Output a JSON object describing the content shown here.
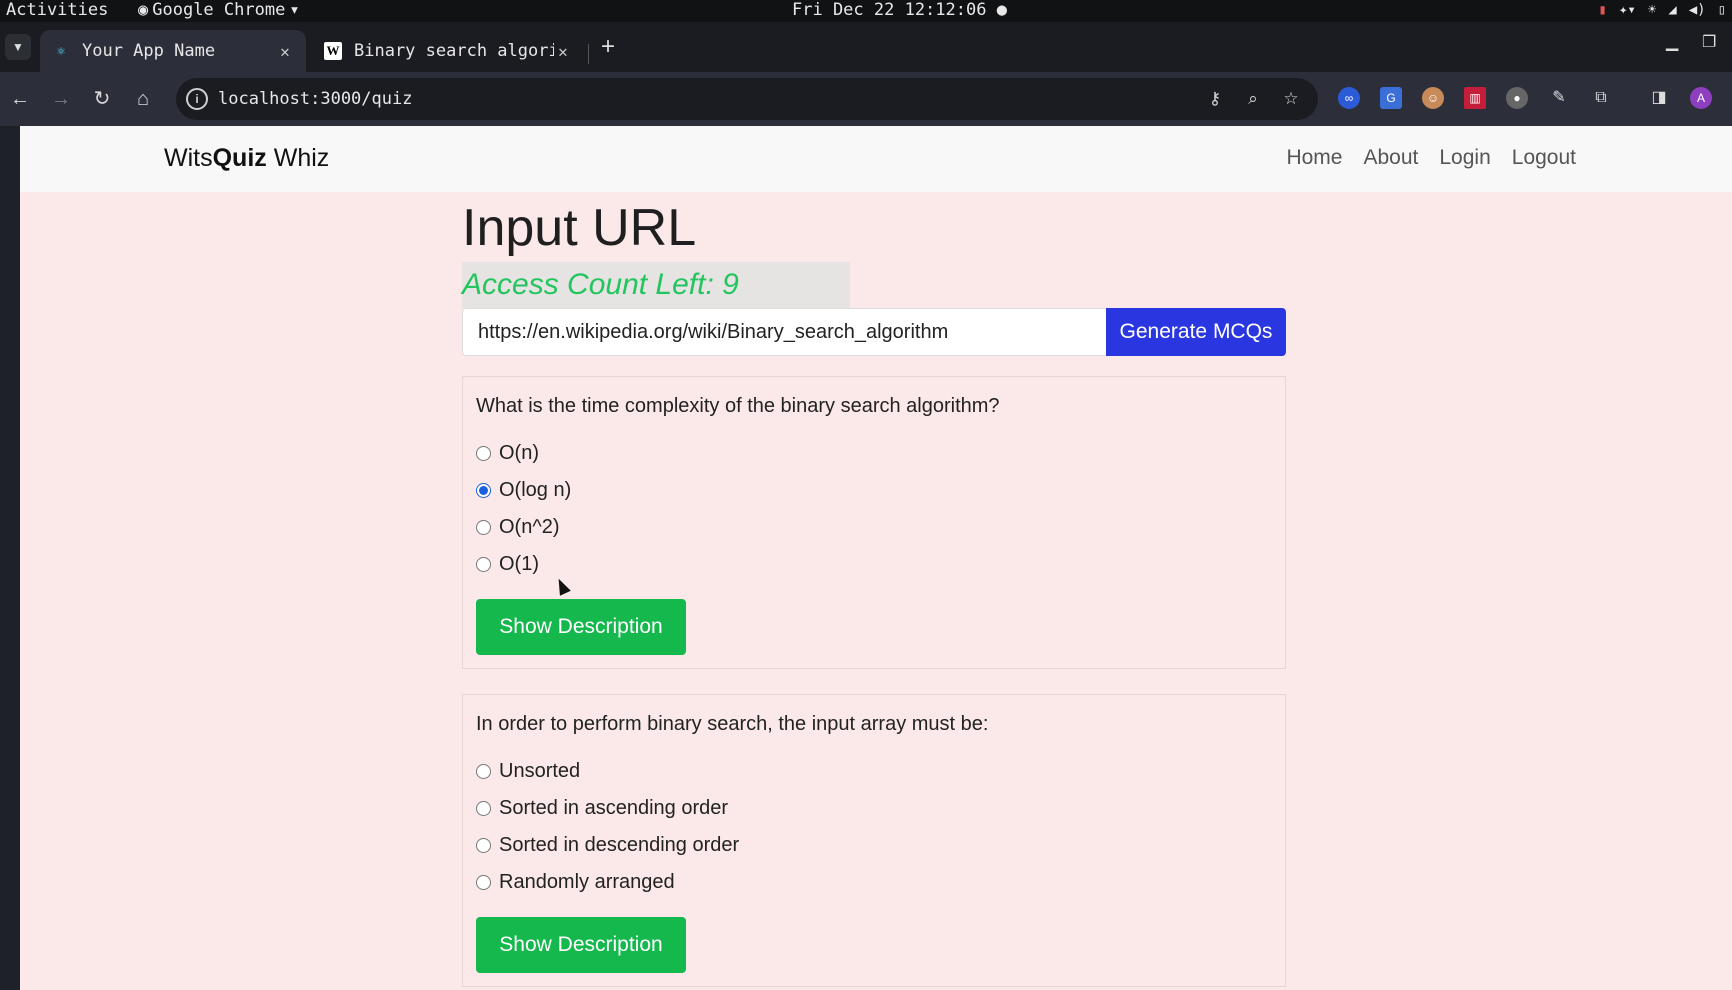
{
  "system": {
    "activities": "Activities",
    "app_name": "Google Chrome",
    "clock": "Fri Dec 22  12:12:06"
  },
  "browser": {
    "tabs": [
      {
        "title": "Your App Name",
        "favicon": "react-icon",
        "active": true
      },
      {
        "title": "Binary search algorithm",
        "favicon": "wikipedia-icon",
        "active": false
      }
    ],
    "url": "localhost:3000/quiz",
    "profile_initial": "A"
  },
  "site": {
    "brand_prefix": "Wits",
    "brand_bold": "Quiz",
    "brand_suffix": " Whiz",
    "nav": [
      "Home",
      "About",
      "Login",
      "Logout"
    ]
  },
  "main": {
    "heading": "Input URL",
    "access_count": "Access Count Left: 9",
    "url_value": "https://en.wikipedia.org/wiki/Binary_search_algorithm",
    "generate_label": "Generate MCQs",
    "questions": [
      {
        "text": "What is the time complexity of the binary search algorithm?",
        "options": [
          "O(n)",
          "O(log n)",
          "O(n^2)",
          "O(1)"
        ],
        "selected": 1,
        "button": "Show Description"
      },
      {
        "text": "In order to perform binary search, the input array must be:",
        "options": [
          "Unsorted",
          "Sorted in ascending order",
          "Sorted in descending order",
          "Randomly arranged"
        ],
        "selected": -1,
        "button": "Show Description"
      }
    ]
  },
  "colors": {
    "page_bg": "#fbe9e9",
    "primary": "#2a37e0",
    "success": "#14b84d",
    "access_text": "#22c55e"
  }
}
